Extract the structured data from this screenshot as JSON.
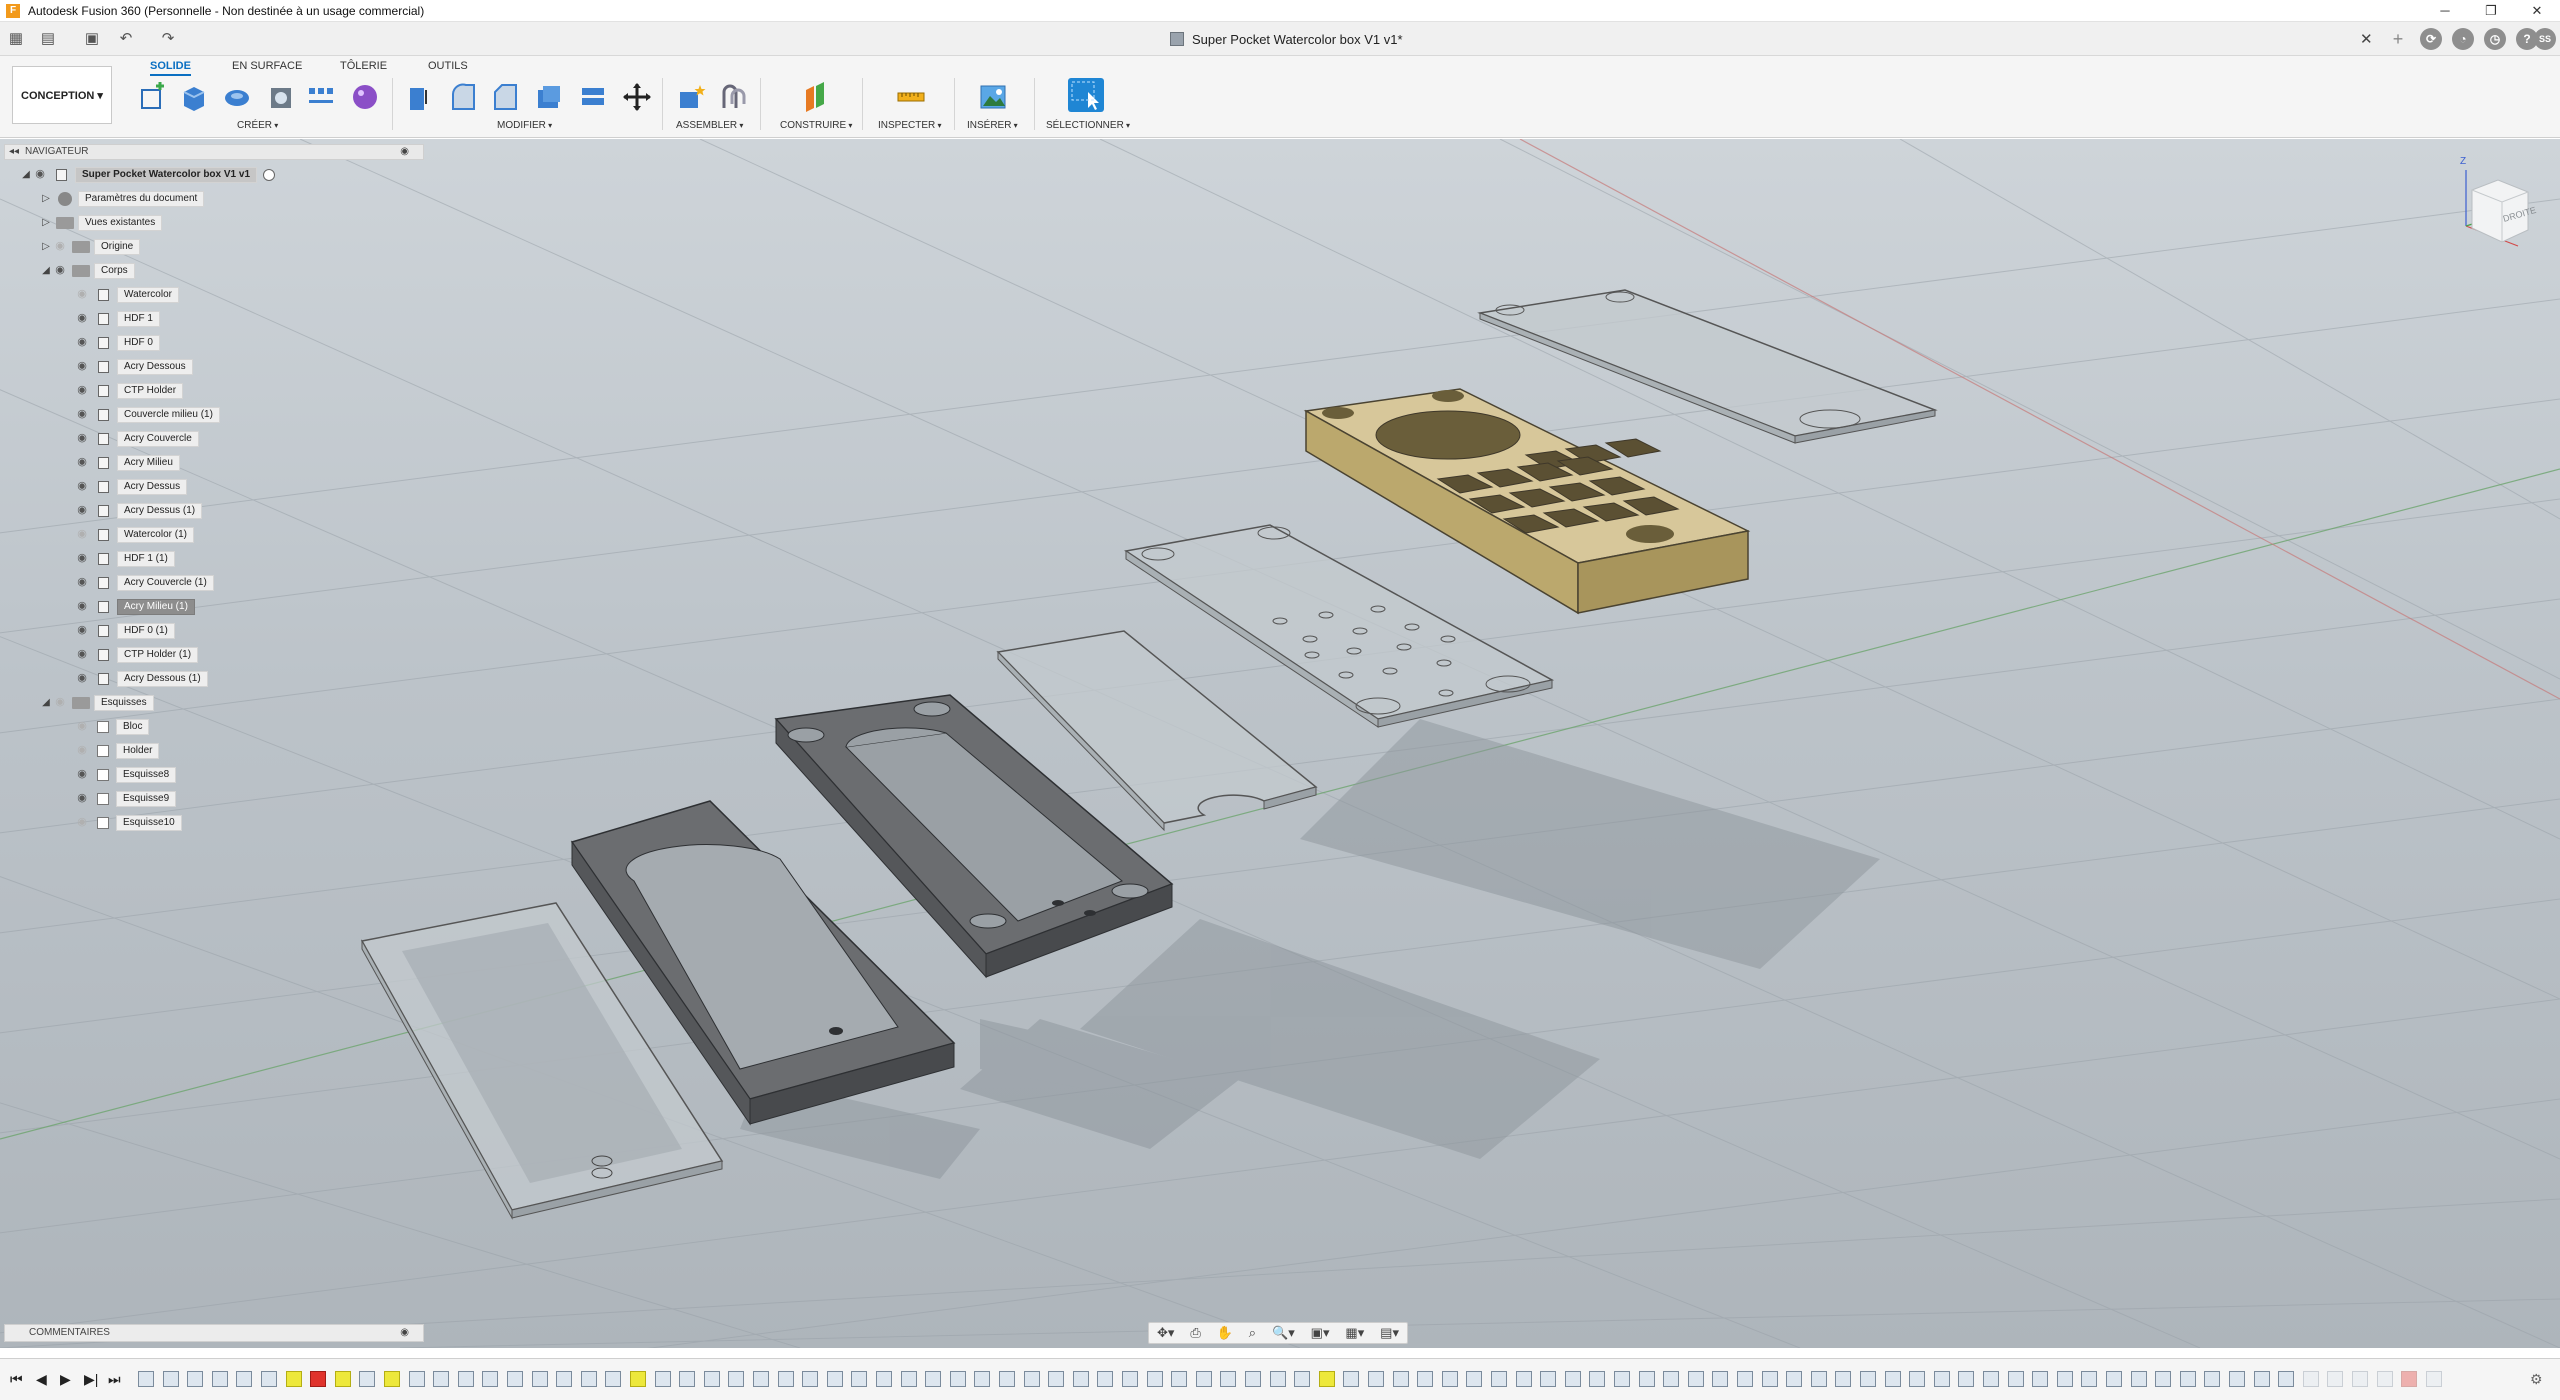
{
  "window": {
    "title": "Autodesk Fusion 360 (Personnelle - Non destinée à un usage commercial)",
    "app_icon": "F",
    "minimize": "─",
    "restore": "❐",
    "close": "✕"
  },
  "quickbar": {
    "document_title": "Super Pocket Watercolor box V1 v1*",
    "close_tab": "✕",
    "user_initials": "SS",
    "help": "?"
  },
  "ribbon": {
    "workspace": "CONCEPTION ▾",
    "tabs": [
      "SOLIDE",
      "EN SURFACE",
      "TÔLERIE",
      "OUTILS"
    ],
    "groups": [
      "CRÉER",
      "MODIFIER",
      "ASSEMBLER",
      "CONSTRUIRE",
      "INSPECTER",
      "INSÉRER",
      "SÉLECTIONNER"
    ],
    "colors": {
      "active_tab": "#0a6fc2",
      "select_icon": "#1f86d4"
    }
  },
  "navigator": {
    "header": "NAVIGATEUR",
    "collapse": "◂◂",
    "pin": "◉",
    "root": "Super Pocket Watercolor box V1 v1",
    "top_nodes": [
      "Paramètres du document",
      "Vues existantes",
      "Origine",
      "Corps"
    ],
    "bodies": [
      {
        "label": "Watercolor",
        "visible": false
      },
      {
        "label": "HDF 1",
        "visible": true
      },
      {
        "label": "HDF 0",
        "visible": true
      },
      {
        "label": "Acry Dessous",
        "visible": true
      },
      {
        "label": "CTP Holder",
        "visible": true
      },
      {
        "label": "Couvercle milieu (1)",
        "visible": true
      },
      {
        "label": "Acry Couvercle",
        "visible": true
      },
      {
        "label": "Acry Milieu",
        "visible": true
      },
      {
        "label": "Acry Dessus",
        "visible": true
      },
      {
        "label": "Acry Dessus (1)",
        "visible": true
      },
      {
        "label": "Watercolor (1)",
        "visible": false
      },
      {
        "label": "HDF 1 (1)",
        "visible": true
      },
      {
        "label": "Acry Couvercle (1)",
        "visible": true
      },
      {
        "label": "Acry Milieu (1)",
        "visible": true,
        "selected": true
      },
      {
        "label": "HDF 0 (1)",
        "visible": true
      },
      {
        "label": "CTP Holder (1)",
        "visible": true
      },
      {
        "label": "Acry Dessous (1)",
        "visible": true
      }
    ],
    "sketch_folder": "Esquisses",
    "sketches": [
      {
        "label": "Bloc",
        "visible": false
      },
      {
        "label": "Holder",
        "visible": false
      },
      {
        "label": "Esquisse8",
        "visible": true
      },
      {
        "label": "Esquisse9",
        "visible": true
      },
      {
        "label": "Esquisse10",
        "visible": false
      }
    ]
  },
  "viewcube": {
    "face": "DROITE",
    "axis_z": "Z"
  },
  "comments": {
    "label": "COMMENTAIRES",
    "pin": "◉"
  },
  "timeline": {
    "controls": [
      "⏮",
      "◀",
      "▶",
      "▶|",
      "⏭"
    ],
    "feature_count": 94,
    "highlighted_yellow": [
      6,
      8,
      10,
      20,
      48
    ],
    "highlighted_red": [
      7,
      92
    ]
  },
  "navtools": [
    "✥▾",
    "⎙",
    "✋",
    "⌕",
    "🔍▾",
    "▣▾",
    "▦▾",
    "▤▾"
  ]
}
